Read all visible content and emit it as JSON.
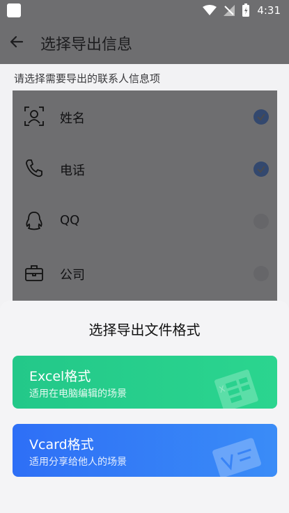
{
  "status_bar": {
    "time": "4:31"
  },
  "header": {
    "title": "选择导出信息",
    "back_icon": "arrow-left"
  },
  "subtitle": "请选择需要导出的联系人信息项",
  "fields": [
    {
      "label": "姓名",
      "icon": "person-icon",
      "checked": true
    },
    {
      "label": "电话",
      "icon": "phone-icon",
      "checked": true
    },
    {
      "label": "QQ",
      "icon": "qq-icon",
      "checked": false
    },
    {
      "label": "公司",
      "icon": "briefcase-icon",
      "checked": false
    }
  ],
  "sheet": {
    "title": "选择导出文件格式",
    "options": [
      {
        "title": "Excel格式",
        "desc": "适用在电脑编辑的场景",
        "color": "#27cd8c"
      },
      {
        "title": "Vcard格式",
        "desc": "适用分享给他人的场景",
        "color": "#3478f6"
      }
    ]
  },
  "colors": {
    "check": "#33486e",
    "dim": "#6e6e70"
  }
}
